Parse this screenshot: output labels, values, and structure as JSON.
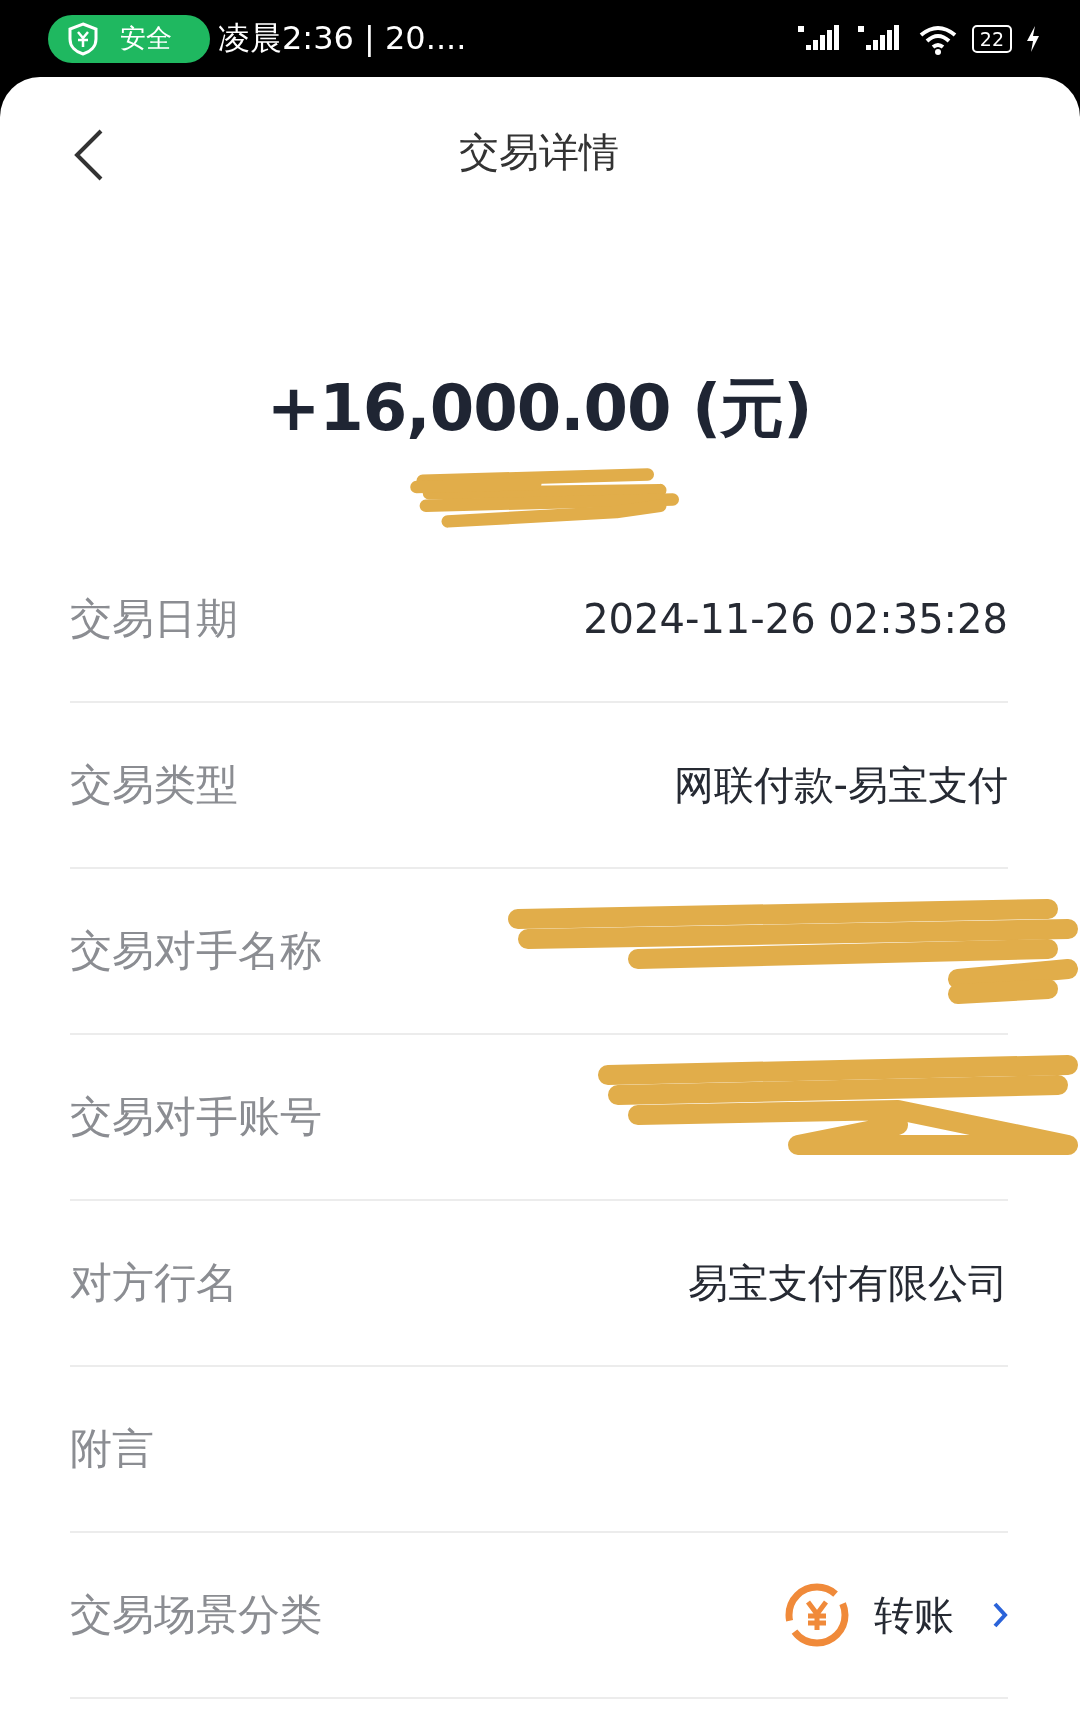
{
  "status_bar": {
    "security_badge": "安全",
    "time": "凌晨2:36 | 20....",
    "battery": "22"
  },
  "header": {
    "title": "交易详情"
  },
  "amount": {
    "text": "+16,000.00 (元)",
    "redacted_below": true
  },
  "details": [
    {
      "label": "交易日期",
      "value": "2024-11-26 02:35:28",
      "redacted": false
    },
    {
      "label": "交易类型",
      "value": "网联付款-易宝支付",
      "redacted": false
    },
    {
      "label": "交易对手名称",
      "redacted": true
    },
    {
      "label": "交易对手账号",
      "redacted": true
    },
    {
      "label": "对方行名",
      "value": "易宝支付有限公司",
      "redacted": false
    },
    {
      "label": "附言",
      "redacted": false
    },
    {
      "label": "交易场景分类",
      "kind": "category",
      "value": "转账",
      "redacted": false
    }
  ]
}
